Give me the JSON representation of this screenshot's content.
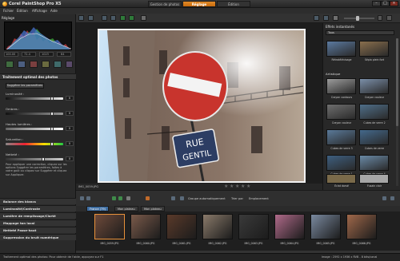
{
  "titlebar": {
    "title": "Corel PaintShop Pro X5"
  },
  "mode_tabs": [
    "Gestion de photos",
    "Réglage",
    "Édition"
  ],
  "menu": [
    "Fichier",
    "Édition",
    "Affichage",
    "Aide"
  ],
  "left_panel": {
    "header": "Réglage",
    "histogram_fields": [
      "100.00",
      "72.4",
      "1023",
      "64"
    ],
    "section_title": "Traitement optimal des photos",
    "suggest_button": "Suggérer les paramètres",
    "sliders": [
      {
        "label": "Luminosité :",
        "value": "0",
        "level": 0.8
      },
      {
        "label": "Ombres :",
        "value": "0",
        "level": 0.8
      },
      {
        "label": "Hautes lumières :",
        "value": "0",
        "level": 0.8
      },
      {
        "label": "Saturation :",
        "value": "0",
        "level": 0.8
      },
      {
        "label": "Netteté :",
        "value": "0",
        "level": 0.65
      }
    ],
    "help_text": "Pour appliquer une correction, cliquez sur les options Suggérer les paramètres, faites à votre goût ou cliquez sur Suggérer et cliquez sur Appliquer.",
    "sections": [
      "Balance des blancs",
      "Luminosité/Contraste",
      "Lumière de remplissage/Clarté",
      "Mappage ton local",
      "Netteté Passe-haut",
      "Suppression du bruit numérique"
    ]
  },
  "right_panel": {
    "header": "Effets instantanés",
    "dropdown": "Tous",
    "categories": [
      "Artistique"
    ],
    "effects": [
      {
        "label": "Rétrotélévisage",
        "color": "#5b7aa0"
      },
      {
        "label": "Sépia plein fort",
        "color": "#8a6f4d"
      },
      {
        "label": "Crayon contours",
        "color": "#9c9c9c"
      },
      {
        "label": "Crayon couleur",
        "color": "#7b8fa8"
      },
      {
        "label": "Crayon couleur",
        "color": "#6f6f6f"
      },
      {
        "label": "Cubes de verre 2",
        "color": "#4f6f8a"
      },
      {
        "label": "Cubes de verre 3",
        "color": "#5a7a9a"
      },
      {
        "label": "Cubes de verre",
        "color": "#44698c"
      },
      {
        "label": "Cubes de verre 1",
        "color": "#3e5f80"
      },
      {
        "label": "Cubes de verre 4",
        "color": "#6a8aa6"
      },
      {
        "label": "Éclat dorsé",
        "color": "#7a6a4a"
      },
      {
        "label": "Fusain clair",
        "color": "#a6a6a6"
      }
    ]
  },
  "preview": {
    "filename": "IMG_0059.JPG"
  },
  "organizer": {
    "group_label": "Groupe automatiquement",
    "sort_label": "Trier par",
    "location_label": "Emplacement",
    "tabs": [
      "France (79)",
      "Mon plateau",
      "Mon plateau"
    ],
    "thumbs": [
      {
        "label": "IMG_0059.JPG",
        "color": "#6e4a3a"
      },
      {
        "label": "IMG_0060.JPG",
        "color": "#7a5a4a"
      },
      {
        "label": "IMG_0061.JPG",
        "color": "#5a3a2a"
      },
      {
        "label": "IMG_0062.JPG",
        "color": "#8a7a6a"
      },
      {
        "label": "IMG_0063.JPG",
        "color": "#3a3a3a"
      },
      {
        "label": "IMG_0064.JPG",
        "color": "#b06a8a"
      },
      {
        "label": "IMG_0065.JPG",
        "color": "#7a8aa0"
      },
      {
        "label": "IMG_0066.JPG",
        "color": "#a0684a"
      }
    ]
  },
  "photo_scene": {
    "sign_text_line1": "RUE",
    "sign_text_line2": "GENTIL"
  },
  "status": {
    "text": "Traitement optimal des photos: Pour obtenir de l'aide, appuyez sur F1",
    "info": "Image : 2592 x 1936 x RVB - 8 bits/canal"
  }
}
